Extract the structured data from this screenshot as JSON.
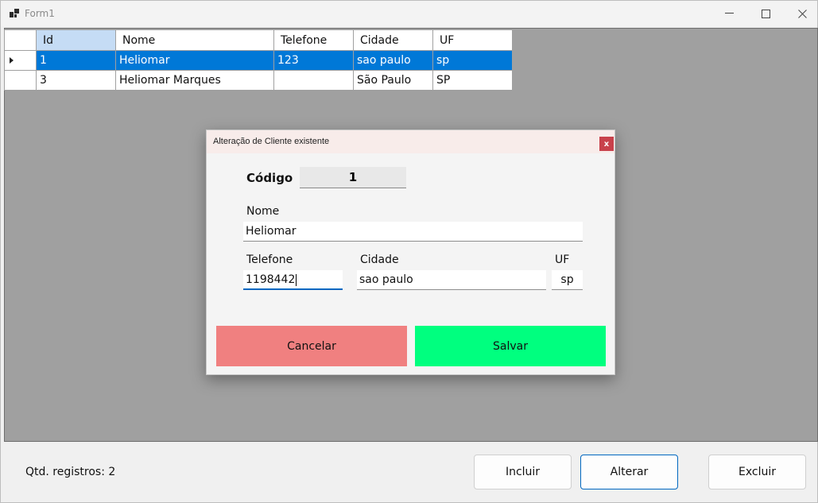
{
  "window": {
    "title": "Form1"
  },
  "grid": {
    "headers": [
      "Id",
      "Nome",
      "Telefone",
      "Cidade",
      "UF"
    ],
    "rows": [
      {
        "id": "1",
        "nome": "Heliomar",
        "telefone": "123",
        "cidade": "sao paulo",
        "uf": "sp"
      },
      {
        "id": "3",
        "nome": "Heliomar Marques",
        "telefone": "",
        "cidade": "São Paulo",
        "uf": "SP"
      }
    ]
  },
  "dialog": {
    "title": "Alteração de Cliente existente",
    "close_label": "x",
    "codigo_label": "Código",
    "codigo_value": "1",
    "nome_label": "Nome",
    "nome_value": "Heliomar",
    "telefone_label": "Telefone",
    "telefone_value": "1198442",
    "cidade_label": "Cidade",
    "cidade_value": "sao paulo",
    "uf_label": "UF",
    "uf_value": "sp",
    "cancel_label": "Cancelar",
    "save_label": "Salvar"
  },
  "footer": {
    "count_label": "Qtd. registros: 2",
    "incluir_label": "Incluir",
    "alterar_label": "Alterar",
    "excluir_label": "Excluir"
  },
  "colors": {
    "selection": "#0078d7",
    "cancel_button": "#f08080",
    "save_button": "#00ff7f",
    "workspace": "#a0a0a0"
  }
}
